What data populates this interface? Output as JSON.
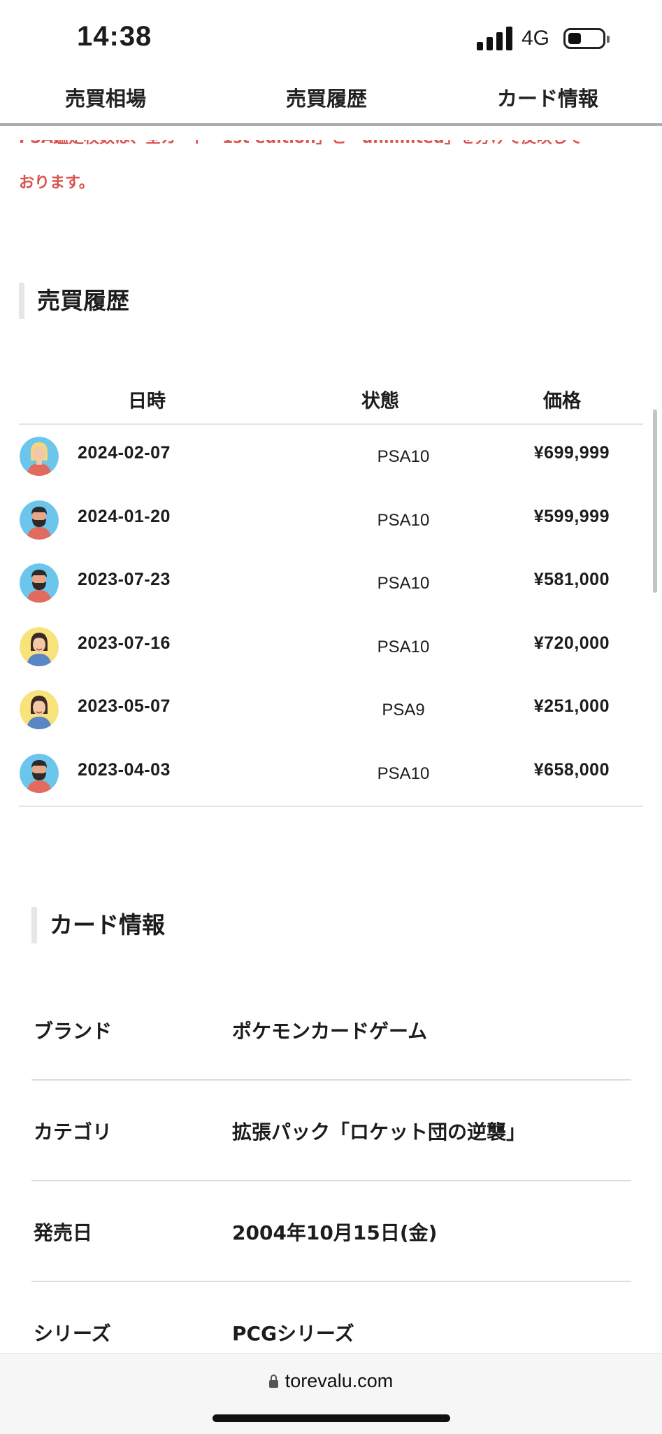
{
  "status_bar": {
    "time": "14:38",
    "network": "4G"
  },
  "tabs": [
    {
      "label": "売買相場"
    },
    {
      "label": "売買履歴"
    },
    {
      "label": "カード情報"
    }
  ],
  "notice": {
    "line1": "PSA鑑定枚数は、全カード「1st edition」と「unlimited」を分けて反映して",
    "line2": "おります。"
  },
  "history": {
    "heading": "売買履歴",
    "columns": {
      "date": "日時",
      "grade": "状態",
      "price": "価格"
    },
    "rows": [
      {
        "avatar": "blonde-woman-avatar",
        "date": "2024-02-07",
        "grade": "PSA10",
        "price": "¥699,999"
      },
      {
        "avatar": "bearded-man-avatar",
        "date": "2024-01-20",
        "grade": "PSA10",
        "price": "¥599,999"
      },
      {
        "avatar": "bearded-man-avatar",
        "date": "2023-07-23",
        "grade": "PSA10",
        "price": "¥581,000"
      },
      {
        "avatar": "brunette-woman-avatar",
        "date": "2023-07-16",
        "grade": "PSA10",
        "price": "¥720,000"
      },
      {
        "avatar": "brunette-woman-avatar",
        "date": "2023-05-07",
        "grade": "PSA9",
        "price": "¥251,000"
      },
      {
        "avatar": "bearded-man-avatar",
        "date": "2023-04-03",
        "grade": "PSA10",
        "price": "¥658,000"
      }
    ]
  },
  "card_info": {
    "heading": "カード情報",
    "rows": [
      {
        "label": "ブランド",
        "value": "ポケモンカードゲーム"
      },
      {
        "label": "カテゴリ",
        "value": "拡張パック「ロケット団の逆襲」"
      },
      {
        "label": "発売日",
        "value": "2004年10月15日(金)"
      },
      {
        "label": "シリーズ",
        "value": "PCGシリーズ"
      }
    ]
  },
  "browser": {
    "url": "torevalu.com"
  },
  "colors": {
    "notice": "#d9534f",
    "heading_bar": "#e6e6e6",
    "avatar_blue": "#6cc6ec",
    "avatar_yellow": "#f7e37a"
  }
}
